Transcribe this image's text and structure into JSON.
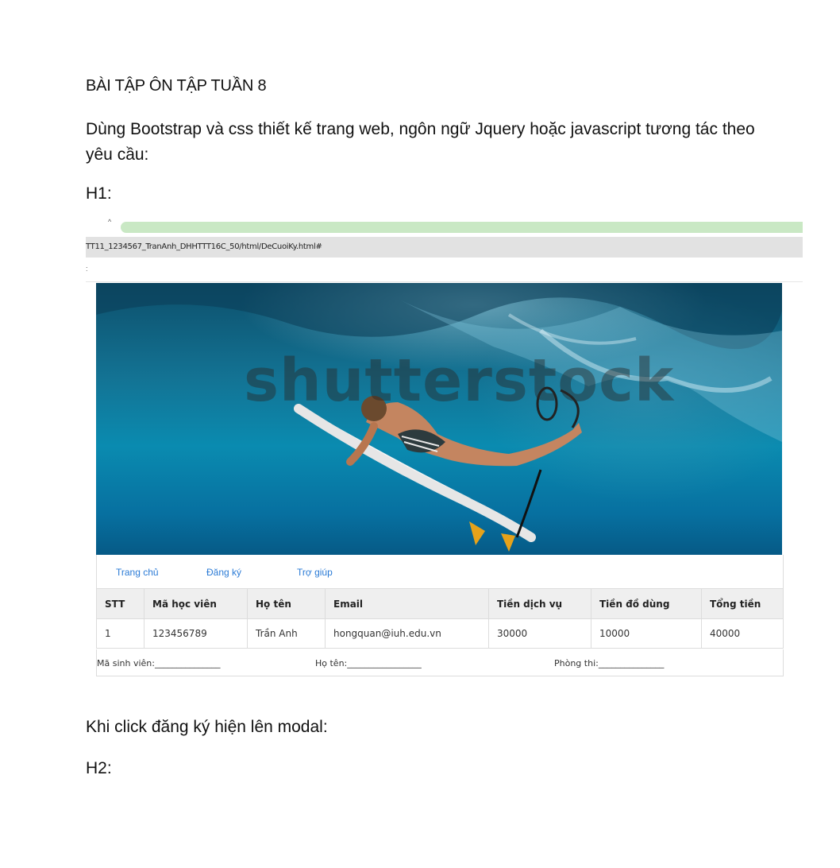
{
  "doc": {
    "heading": "BÀI TẬP ÔN TẬP TUẦN 8",
    "intro": "Dùng Bootstrap và css thiết kế trang web, ngôn ngữ Jquery hoặc javascript tương tác theo yêu cầu:",
    "h1_label": "H1:",
    "after_text": "Khi click đăng ký hiện lên modal:",
    "h2_label": "H2:"
  },
  "browser": {
    "url": "TT11_1234567_TranAnh_DHHTTT16C_50/html/DeCuoiKy.html#"
  },
  "hero": {
    "watermark": "shutterstock"
  },
  "nav": {
    "items": [
      "Trang chủ",
      "Đăng ký",
      "Trợ giúp"
    ]
  },
  "table": {
    "headers": [
      "STT",
      "Mã học viên",
      "Họ tên",
      "Email",
      "Tiền dịch vụ",
      "Tiền đồ dùng",
      "Tổng tiền"
    ],
    "rows": [
      [
        "1",
        "123456789",
        "Trần Anh",
        "hongquan@iuh.edu.vn",
        "30000",
        "10000",
        "40000"
      ]
    ]
  },
  "footer": {
    "student_id": "Mã sinh viên:_______________",
    "name": "Họ tên:_________________",
    "room": "Phòng thi:_______________"
  },
  "colors": {
    "link": "#2b7bd6",
    "tab_green": "#c9e8c4",
    "ocean": "#0a8bb0"
  }
}
